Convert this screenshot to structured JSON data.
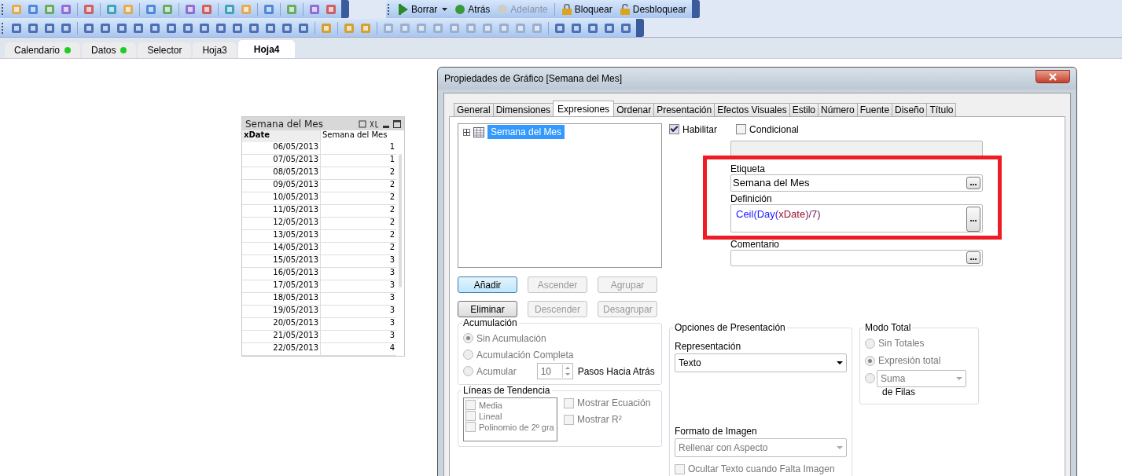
{
  "toolbar_top": {
    "buttons": [
      {
        "label": "Borrar",
        "kind": "dropdown",
        "disabled": false
      },
      {
        "label": "Atrás",
        "kind": "back",
        "disabled": false
      },
      {
        "label": "Adelante",
        "kind": "forward",
        "disabled": true
      },
      {
        "label": "Bloquear",
        "kind": "lock",
        "disabled": false
      },
      {
        "label": "Desbloquear",
        "kind": "unlock",
        "disabled": false
      }
    ]
  },
  "sheet_tabs": [
    {
      "label": "Calendario",
      "dot": true,
      "selected": false
    },
    {
      "label": "Datos",
      "dot": true,
      "selected": false
    },
    {
      "label": "Selector",
      "dot": false,
      "selected": false
    },
    {
      "label": "Hoja3",
      "dot": false,
      "selected": false
    },
    {
      "label": "Hoja4",
      "dot": false,
      "selected": true
    }
  ],
  "table_box": {
    "title": "Semana del Mes",
    "columns": [
      "xDate",
      "Semana del Mes"
    ],
    "rows": [
      [
        "06/05/2013",
        "1"
      ],
      [
        "07/05/2013",
        "1"
      ],
      [
        "08/05/2013",
        "2"
      ],
      [
        "09/05/2013",
        "2"
      ],
      [
        "10/05/2013",
        "2"
      ],
      [
        "11/05/2013",
        "2"
      ],
      [
        "12/05/2013",
        "2"
      ],
      [
        "13/05/2013",
        "2"
      ],
      [
        "14/05/2013",
        "2"
      ],
      [
        "15/05/2013",
        "3"
      ],
      [
        "16/05/2013",
        "3"
      ],
      [
        "17/05/2013",
        "3"
      ],
      [
        "18/05/2013",
        "3"
      ],
      [
        "19/05/2013",
        "3"
      ],
      [
        "20/05/2013",
        "3"
      ],
      [
        "21/05/2013",
        "3"
      ],
      [
        "22/05/2013",
        "4"
      ]
    ]
  },
  "dialog": {
    "title": "Propiedades de Gráfico [Semana del Mes]",
    "tabs": [
      {
        "label": "General",
        "selected": false
      },
      {
        "label": "Dimensiones",
        "selected": false
      },
      {
        "label": "Expresiones",
        "selected": true
      },
      {
        "label": "Ordenar",
        "selected": false
      },
      {
        "label": "Presentación",
        "selected": false
      },
      {
        "label": "Efectos Visuales",
        "selected": false
      },
      {
        "label": "Estilo",
        "selected": false
      },
      {
        "label": "Número",
        "selected": false
      },
      {
        "label": "Fuente",
        "selected": false
      },
      {
        "label": "Diseño",
        "selected": false
      },
      {
        "label": "Título",
        "selected": false
      }
    ],
    "expressions": [
      {
        "label": "Semana del Mes",
        "selected": true
      }
    ],
    "enable": {
      "label": "Habilitar",
      "checked": true
    },
    "conditional": {
      "label": "Condicional",
      "checked": false
    },
    "label_field": {
      "label": "Etiqueta",
      "value": "Semana del Mes"
    },
    "definition": {
      "label": "Definición",
      "segments": [
        {
          "text": "Ceil(",
          "kind": "function"
        },
        {
          "text": "Day(",
          "kind": "function"
        },
        {
          "text": "xDate",
          "kind": "field"
        },
        {
          "text": ")/7)",
          "kind": "operator"
        }
      ]
    },
    "comment": {
      "label": "Comentario"
    },
    "buttons": [
      [
        {
          "label": "Añadir",
          "disabled": false
        },
        {
          "label": "Ascender",
          "disabled": true
        },
        {
          "label": "Agrupar",
          "disabled": true
        }
      ],
      [
        {
          "label": "Eliminar",
          "disabled": false
        },
        {
          "label": "Descender",
          "disabled": true
        },
        {
          "label": "Desagrupar",
          "disabled": true
        }
      ]
    ],
    "accumulation": {
      "title": "Acumulación",
      "options": [
        {
          "label": "Sin Acumulación",
          "selected": true
        },
        {
          "label": "Acumulación Completa",
          "selected": false
        },
        {
          "label": "Acumular",
          "selected": false
        }
      ],
      "steps": "10",
      "steps_label": "Pasos Hacia Atrás"
    },
    "trendlines": {
      "title": "Líneas de Tendencia",
      "items": [
        {
          "label": "Media",
          "checked": false
        },
        {
          "label": "Lineal",
          "checked": false
        },
        {
          "label": "Polinomio de 2º gra",
          "checked": false
        }
      ],
      "options": [
        {
          "label": "Mostrar Ecuación",
          "checked": false
        },
        {
          "label": "Mostrar R²",
          "checked": false
        }
      ]
    },
    "presentation": {
      "title": "Opciones de Presentación",
      "representation_label": "Representación",
      "representation": "Texto",
      "image_format_label": "Formato de Imagen",
      "image_format": "Rellenar con Aspecto",
      "hide_text": {
        "label": "Ocultar Texto cuando Falta Imagen",
        "checked": false
      }
    },
    "total_mode": {
      "title": "Modo Total",
      "options": [
        {
          "label": "Sin Totales",
          "selected": false
        },
        {
          "label": "Expresión total",
          "selected": true
        },
        {
          "selected": false
        }
      ],
      "function": "Suma",
      "suffix": "de Filas"
    }
  }
}
